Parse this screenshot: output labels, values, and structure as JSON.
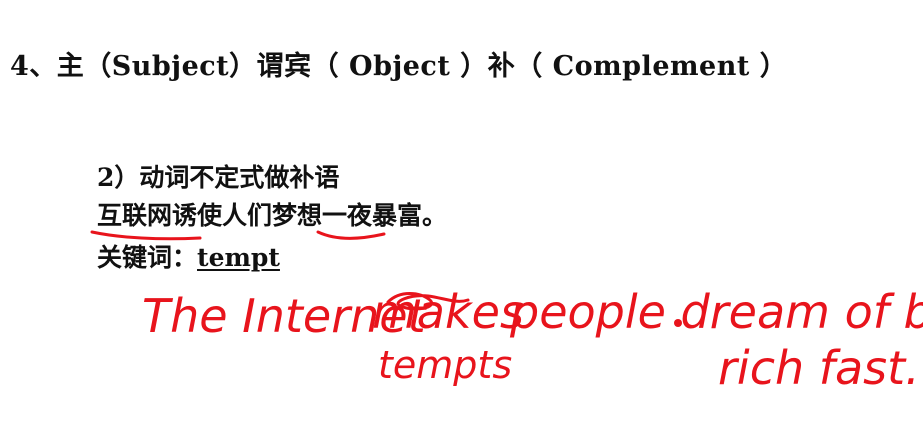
{
  "heading": {
    "text": "4、主（Subject）谓宾（ Object ）补（ Complement ）"
  },
  "section": {
    "title": "2）动词不定式做补语",
    "sentence": "互联网诱使人们梦想一夜暴富。",
    "keyword_label": "关键词：",
    "keyword": "tempt"
  },
  "handwriting": {
    "translation_line1_a": "The Internet",
    "crossed_word": "makes",
    "translation_line1_b": "people dream of being",
    "translation_line2": "rich fast.",
    "correction": "tempts",
    "ink_color": "#e8141c"
  }
}
